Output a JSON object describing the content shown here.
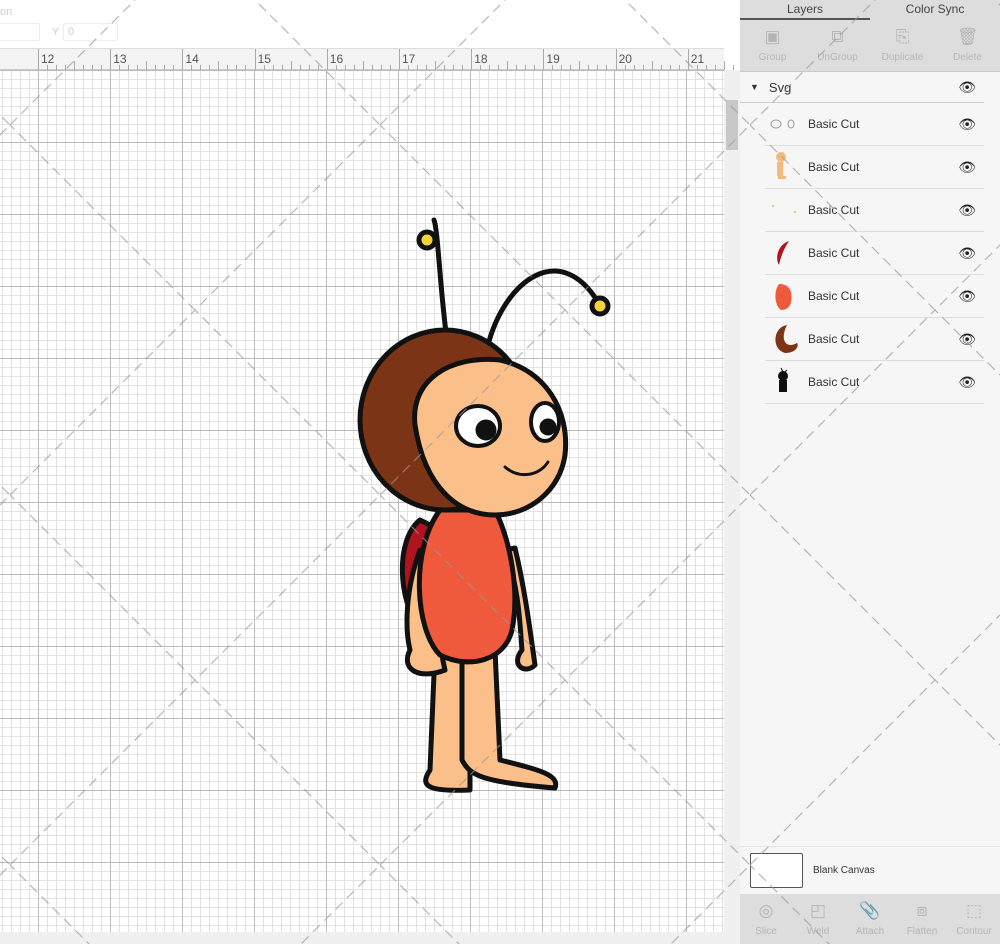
{
  "topbar": {
    "position_label": "on",
    "y_label": "Y",
    "y_value": "0"
  },
  "ruler": {
    "ticks": [
      "12",
      "13",
      "14",
      "15",
      "16",
      "17",
      "18",
      "19",
      "20",
      "21"
    ]
  },
  "panel": {
    "tabs": [
      {
        "label": "Layers",
        "active": true
      },
      {
        "label": "Color Sync",
        "active": false
      }
    ],
    "tools": [
      {
        "label": "Group",
        "icon": "group-icon",
        "glyph": "▣"
      },
      {
        "label": "UnGroup",
        "icon": "ungroup-icon",
        "glyph": "⧉"
      },
      {
        "label": "Duplicate",
        "icon": "duplicate-icon",
        "glyph": "⎘"
      },
      {
        "label": "Delete",
        "icon": "trash-icon",
        "glyph": "🗑"
      }
    ],
    "group": {
      "name": "Svg",
      "expanded": true
    },
    "layers": [
      {
        "name": "Basic Cut",
        "thumb": "eyes",
        "color": "#999"
      },
      {
        "name": "Basic Cut",
        "thumb": "skin",
        "color": "#f5b97a"
      },
      {
        "name": "Basic Cut",
        "thumb": "dots",
        "color": "#e8d070"
      },
      {
        "name": "Basic Cut",
        "thumb": "shell",
        "color": "#b0141e"
      },
      {
        "name": "Basic Cut",
        "thumb": "body",
        "color": "#ef5a3c"
      },
      {
        "name": "Basic Cut",
        "thumb": "helmet",
        "color": "#7b3516"
      },
      {
        "name": "Basic Cut",
        "thumb": "outline",
        "color": "#111"
      }
    ],
    "blank_canvas": "Blank Canvas",
    "bottom_tools": [
      {
        "label": "Slice",
        "icon": "slice-icon",
        "glyph": "◎"
      },
      {
        "label": "Weld",
        "icon": "weld-icon",
        "glyph": "◰"
      },
      {
        "label": "Attach",
        "icon": "attach-icon",
        "glyph": "📎"
      },
      {
        "label": "Flatten",
        "icon": "flatten-icon",
        "glyph": "⧈"
      },
      {
        "label": "Contour",
        "icon": "contour-icon",
        "glyph": "⬚"
      }
    ]
  },
  "colors": {
    "helmet": "#7b3516",
    "skin": "#fbc08a",
    "body": "#ef5a3c",
    "antenna_tip": "#f5d33a",
    "shell": "#b0141e"
  }
}
